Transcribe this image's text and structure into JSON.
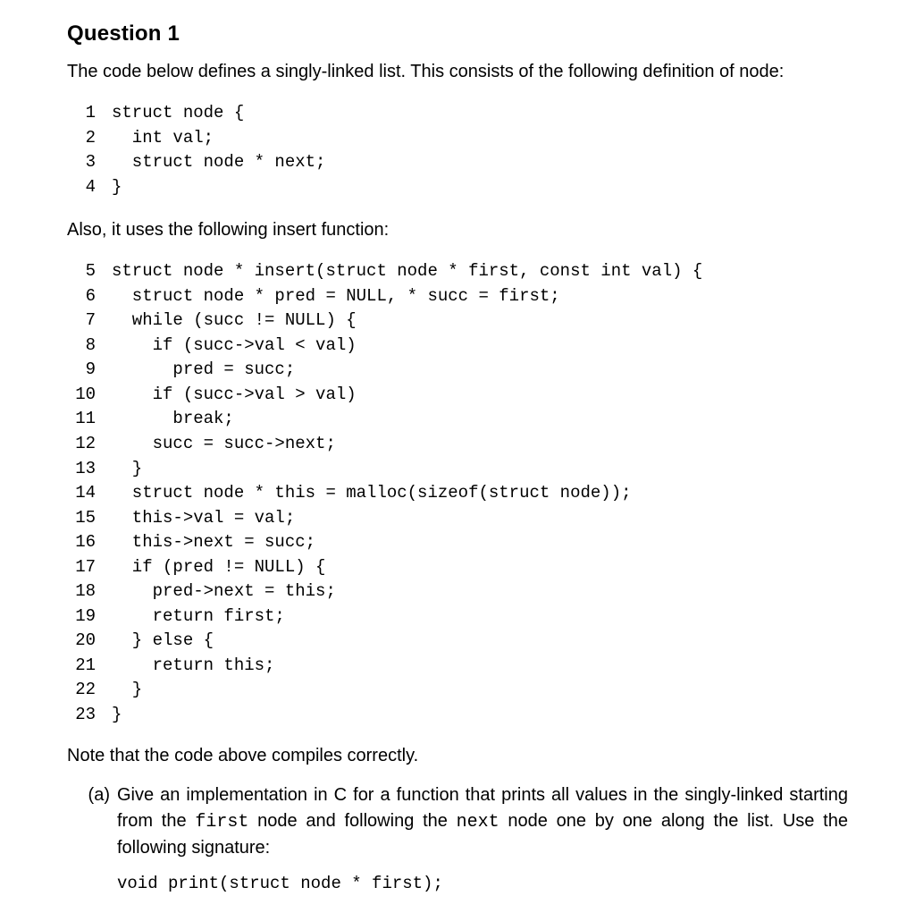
{
  "title": "Question 1",
  "intro": "The code below defines a singly-linked list.  This consists of the following definition of node:",
  "code1": [
    {
      "n": "1",
      "t": "struct node {"
    },
    {
      "n": "2",
      "t": "  int val;"
    },
    {
      "n": "3",
      "t": "  struct node * next;"
    },
    {
      "n": "4",
      "t": "}"
    }
  ],
  "mid": "Also, it uses the following insert function:",
  "code2": [
    {
      "n": "5",
      "t": "struct node * insert(struct node * first, const int val) {"
    },
    {
      "n": "6",
      "t": "  struct node * pred = NULL, * succ = first;"
    },
    {
      "n": "7",
      "t": "  while (succ != NULL) {"
    },
    {
      "n": "8",
      "t": "    if (succ->val < val)"
    },
    {
      "n": "9",
      "t": "      pred = succ;"
    },
    {
      "n": "10",
      "t": "    if (succ->val > val)"
    },
    {
      "n": "11",
      "t": "      break;"
    },
    {
      "n": "12",
      "t": "    succ = succ->next;"
    },
    {
      "n": "13",
      "t": "  }"
    },
    {
      "n": "14",
      "t": "  struct node * this = malloc(sizeof(struct node));"
    },
    {
      "n": "15",
      "t": "  this->val = val;"
    },
    {
      "n": "16",
      "t": "  this->next = succ;"
    },
    {
      "n": "17",
      "t": "  if (pred != NULL) {"
    },
    {
      "n": "18",
      "t": "    pred->next = this;"
    },
    {
      "n": "19",
      "t": "    return first;"
    },
    {
      "n": "20",
      "t": "  } else {"
    },
    {
      "n": "21",
      "t": "    return this;"
    },
    {
      "n": "22",
      "t": "  }"
    },
    {
      "n": "23",
      "t": "}"
    }
  ],
  "note": "Note that the code above compiles correctly.",
  "part_a": {
    "label": "(a)",
    "pre": "Give an implementation in C for a function that prints all values in the singly-linked starting from the ",
    "code1": "first",
    "mid": " node and following the ",
    "code2": "next",
    "post": " node one by one along the list. Use the following signature:"
  },
  "signature": "void print(struct node * first);"
}
